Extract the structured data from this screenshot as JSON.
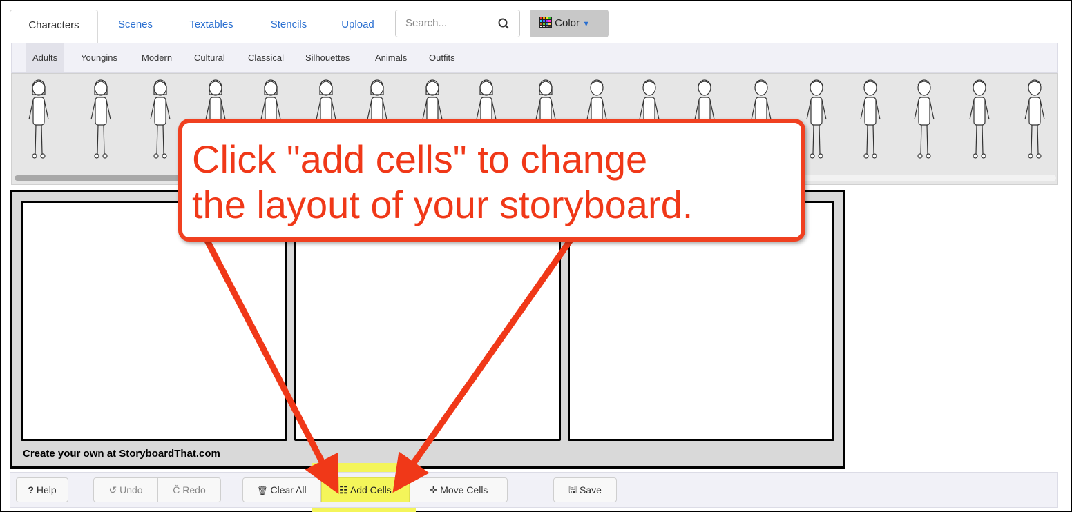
{
  "tabs": {
    "characters": "Characters",
    "scenes": "Scenes",
    "textables": "Textables",
    "stencils": "Stencils",
    "upload": "Upload"
  },
  "search": {
    "placeholder": "Search..."
  },
  "color_button": {
    "label": "Color"
  },
  "subcategories": {
    "adults": "Adults",
    "youngins": "Youngins",
    "modern": "Modern",
    "cultural": "Cultural",
    "classical": "Classical",
    "silhouettes": "Silhouettes",
    "animals": "Animals",
    "outfits": "Outfits"
  },
  "board": {
    "watermark": "Create your own at StoryboardThat.com"
  },
  "callout": {
    "line1": "Click \"add cells\" to change",
    "line2": "the layout of your storyboard."
  },
  "toolbar": {
    "help": "Help",
    "undo": "Undo",
    "redo": "Redo",
    "clear_all": "Clear All",
    "add_cells": "Add Cells",
    "move_cells": "Move Cells",
    "save": "Save"
  },
  "colors": {
    "accent_red": "#f03818",
    "link_blue": "#2a6fd0",
    "highlight": "#f4f55a"
  }
}
